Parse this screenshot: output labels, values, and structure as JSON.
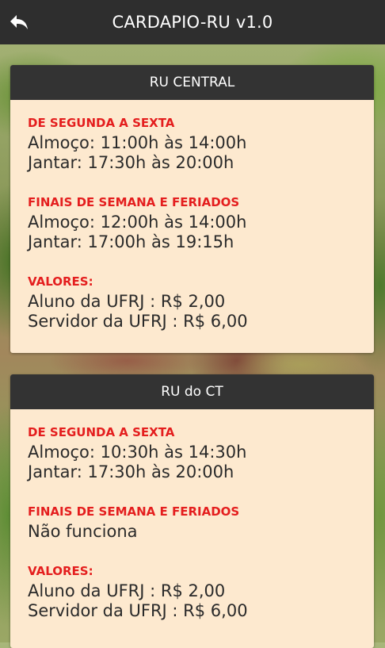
{
  "app": {
    "title": "CARDAPIO-RU v1.0",
    "back_icon": "back-arrow-icon"
  },
  "colors": {
    "appbar": "#2e2e2e",
    "card_header": "#333333",
    "card_body": "#fde9cf",
    "section_title": "#e41e1e",
    "text": "#2a2a2a"
  },
  "cards": [
    {
      "title": "RU CENTRAL",
      "sections": [
        {
          "heading": "DE SEGUNDA A SEXTA",
          "lines": [
            "Almoço: 11:00h às 14:00h",
            "Jantar: 17:30h às 20:00h"
          ]
        },
        {
          "heading": "FINAIS DE SEMANA E FERIADOS",
          "lines": [
            "Almoço: 12:00h às 14:00h",
            "Jantar: 17:00h às 19:15h"
          ]
        },
        {
          "heading": "VALORES:",
          "lines": [
            "Aluno da UFRJ : R$ 2,00",
            "Servidor da UFRJ : R$ 6,00"
          ]
        }
      ]
    },
    {
      "title": "RU do CT",
      "sections": [
        {
          "heading": "DE SEGUNDA A SEXTA",
          "lines": [
            "Almoço: 10:30h às 14:30h",
            "Jantar: 17:30h às 20:00h"
          ]
        },
        {
          "heading": "FINAIS DE SEMANA E FERIADOS",
          "lines": [
            "Não funciona"
          ]
        },
        {
          "heading": "VALORES:",
          "lines": [
            "Aluno da UFRJ : R$ 2,00",
            "Servidor da UFRJ : R$ 6,00"
          ]
        }
      ]
    }
  ]
}
